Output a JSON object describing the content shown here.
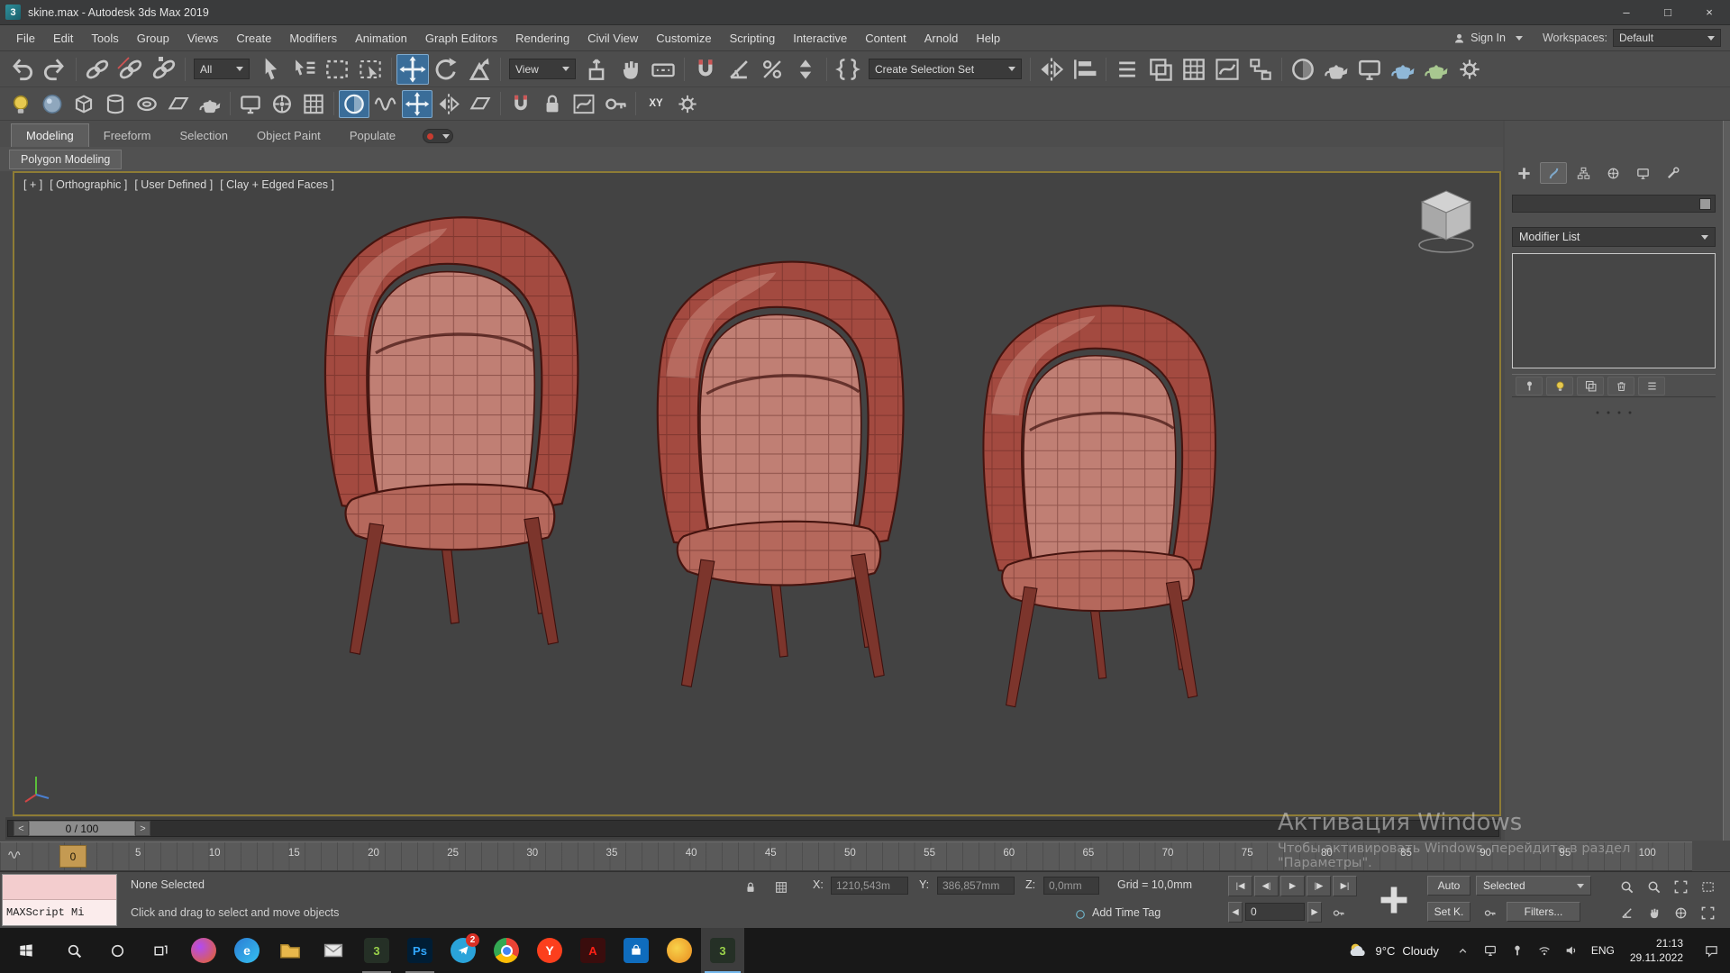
{
  "window": {
    "title": "skine.max - Autodesk 3ds Max 2019",
    "app_icon_letter": "3",
    "minimize": "–",
    "maximize": "□",
    "close": "×"
  },
  "menubar": {
    "items": [
      "File",
      "Edit",
      "Tools",
      "Group",
      "Views",
      "Create",
      "Modifiers",
      "Animation",
      "Graph Editors",
      "Rendering",
      "Civil View",
      "Customize",
      "Scripting",
      "Interactive",
      "Content",
      "Arnold",
      "Help"
    ],
    "sign_in": "Sign In",
    "workspaces_label": "Workspaces:",
    "workspaces_value": "Default"
  },
  "toolbar": {
    "filter_all": "All",
    "ref_coord": "View",
    "create_selection_set": "Create Selection Set",
    "axis_constraint": "XY"
  },
  "ribbon": {
    "tabs": [
      "Modeling",
      "Freeform",
      "Selection",
      "Object Paint",
      "Populate"
    ],
    "subtab": "Polygon Modeling"
  },
  "viewport": {
    "label_general": "[ + ]",
    "label_pov": "[ Orthographic ]",
    "label_camera": "[ User Defined ]",
    "label_shading": "[ Clay + Edged Faces ]"
  },
  "command_panel": {
    "name_value": "",
    "modifier_list": "Modifier List"
  },
  "timeline": {
    "prev": "<",
    "next": ">",
    "handle": "0 / 100",
    "current_frame": "0",
    "tick_labels": [
      "5",
      "10",
      "15",
      "20",
      "25",
      "30",
      "35",
      "40",
      "45",
      "50",
      "55",
      "60",
      "65",
      "70",
      "75",
      "80",
      "85",
      "90",
      "95",
      "100"
    ]
  },
  "status": {
    "selection": "None Selected",
    "prompt": "Click and drag to select and move objects",
    "maxscript": "MAXScript Mi",
    "x_label": "X:",
    "x_value": "1210,543m",
    "y_label": "Y:",
    "y_value": "386,857mm",
    "z_label": "Z:",
    "z_value": "0,0mm",
    "grid": "Grid = 10,0mm",
    "add_time_tag": "Add Time Tag",
    "frame_field": "0",
    "nudge_left": "◀",
    "nudge_right": "▶",
    "playback": {
      "start": "|◀",
      "prev": "◀|",
      "play": "▶",
      "next": "|▶",
      "end": "▶|"
    },
    "auto": "Auto",
    "selected": "Selected",
    "set_key": "Set K.",
    "filters": "Filters..."
  },
  "watermark": {
    "line1": "Активация Windows",
    "line2": "Чтобы активировать Windows, перейдите в раздел",
    "line3": "\"Параметры\"."
  },
  "taskbar": {
    "weather_temp": "9°C",
    "weather_desc": "Cloudy",
    "language": "ENG",
    "time": "21:13",
    "date": "29.11.2022",
    "badge": "2",
    "letters": {
      "edge": "e",
      "max": "3",
      "photoshop": "Ps",
      "yandex": "Y",
      "acrobat": "A"
    }
  },
  "colors": {
    "active_tool_bg": "#3a6d99",
    "viewport_border": "#8e7c35",
    "viewport_bg": "#434343",
    "chair_base": "#a34a40",
    "chair_inner": "#c07f74",
    "chair_seat": "#b5685c",
    "chair_wire": "#58201b"
  }
}
